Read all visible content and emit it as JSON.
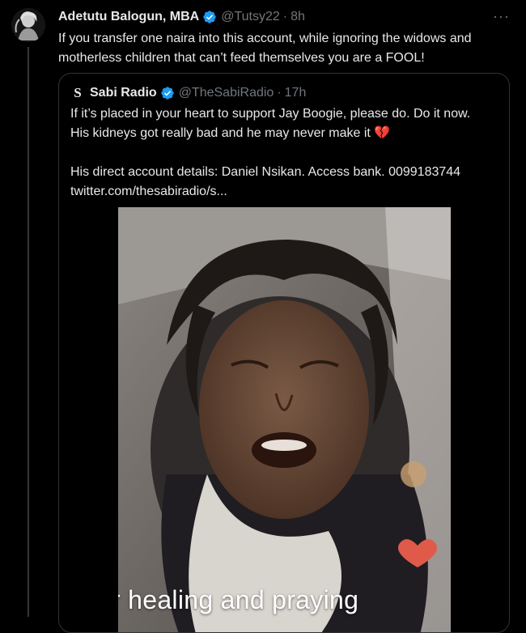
{
  "tweet": {
    "author_name": "Adetutu Balogun, MBA",
    "handle": "@Tutsy22",
    "separator": "·",
    "time": "8h",
    "more_label": "···",
    "text": "If you transfer one naira into this account, while ignoring the widows and motherless children that can’t feed themselves you are a FOOL!"
  },
  "quoted": {
    "avatar_letter": "S",
    "author_name": "Sabi Radio",
    "handle": "@TheSabiRadio",
    "separator": "·",
    "time": "17h",
    "line1": "If it’s placed in your heart to support Jay Boogie, please do. Do it now.",
    "line2": "His kidneys got really bad and he may never make it 💔",
    "line3": "His direct account details: Daniel Nsikan. Access bank. 0099183744",
    "line4": "twitter.com/thesabiradio/s...",
    "media_caption": "r healing and praying"
  },
  "colors": {
    "verified": "#1d9bf0",
    "secondary_text": "#71767b",
    "border": "#2f3336",
    "background": "#000000"
  }
}
